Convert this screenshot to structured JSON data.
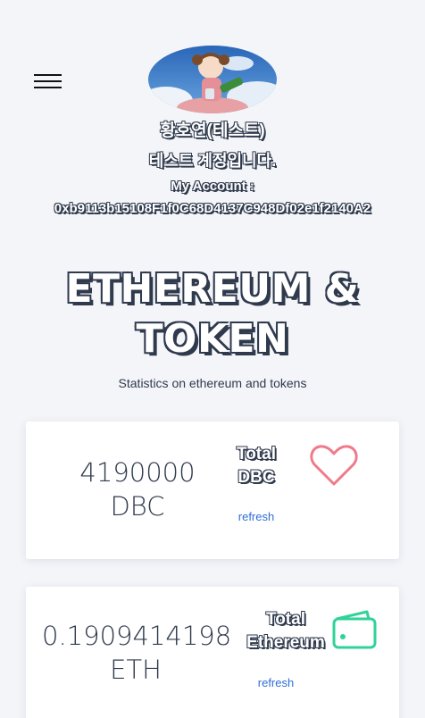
{
  "profile": {
    "name": "황호연(테스트)",
    "description": "테스트 계정입니다.",
    "account_label": "My Account :",
    "account_address": "0xb9113b15108F1f0C68D4137C948Df02e1f2140A2"
  },
  "hero": {
    "title_line1": "ETHEREUM &",
    "title_line2": "TOKEN",
    "subtitle": "Statistics on ethereum and tokens"
  },
  "cards": [
    {
      "value_amount": "4190000",
      "value_unit": "DBC",
      "label_line1": "Total",
      "label_line2": "DBC",
      "refresh_label": "refresh",
      "icon": "heart-icon",
      "icon_color": "#f07a8a"
    },
    {
      "value_amount": "0.1909414198",
      "value_unit": "ETH",
      "label_line1": "Total",
      "label_line2": "Ethereum",
      "refresh_label": "refresh",
      "icon": "wallet-icon",
      "icon_color": "#2fd39a"
    }
  ]
}
